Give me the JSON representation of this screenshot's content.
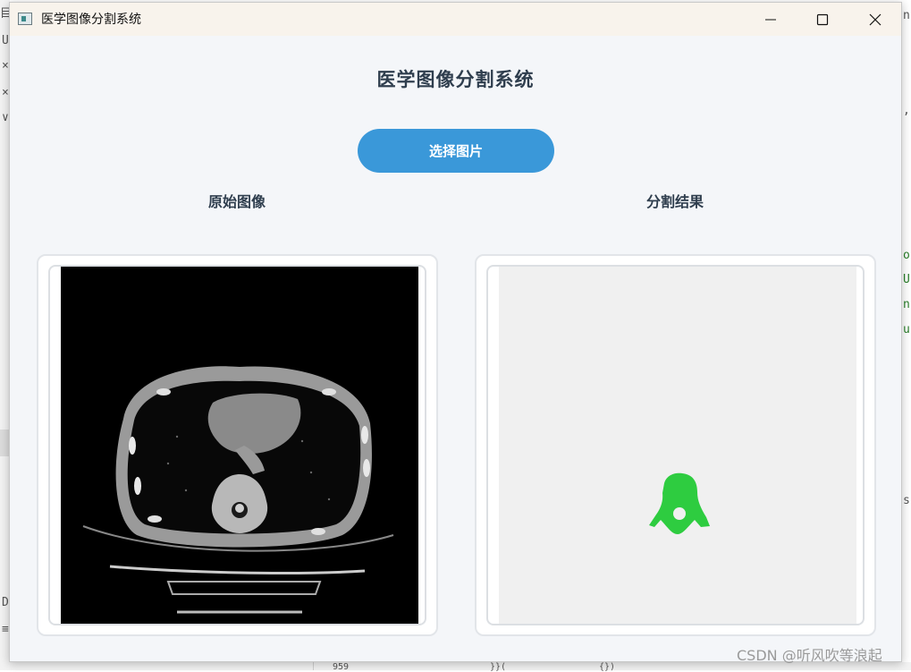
{
  "window": {
    "title": "医学图像分割系统",
    "controls": [
      "minimize-icon",
      "maximize-icon",
      "close-icon"
    ]
  },
  "app": {
    "heading": "医学图像分割系统",
    "select_button_label": "选择图片",
    "original_label": "原始图像",
    "result_label": "分割结果",
    "accent_color": "#3a98d9",
    "segmentation_color": "#2ecc40"
  },
  "background": {
    "left_fragments": [
      "目",
      "U",
      "×",
      "×",
      "∨",
      "D",
      "≡"
    ],
    "right_fragments": [
      "n",
      ",",
      "o",
      "U",
      "n",
      "u",
      "s"
    ],
    "bottom_fragments": [
      "959",
      "}}(",
      "{})"
    ]
  },
  "watermark": "CSDN @听风吹等浪起"
}
